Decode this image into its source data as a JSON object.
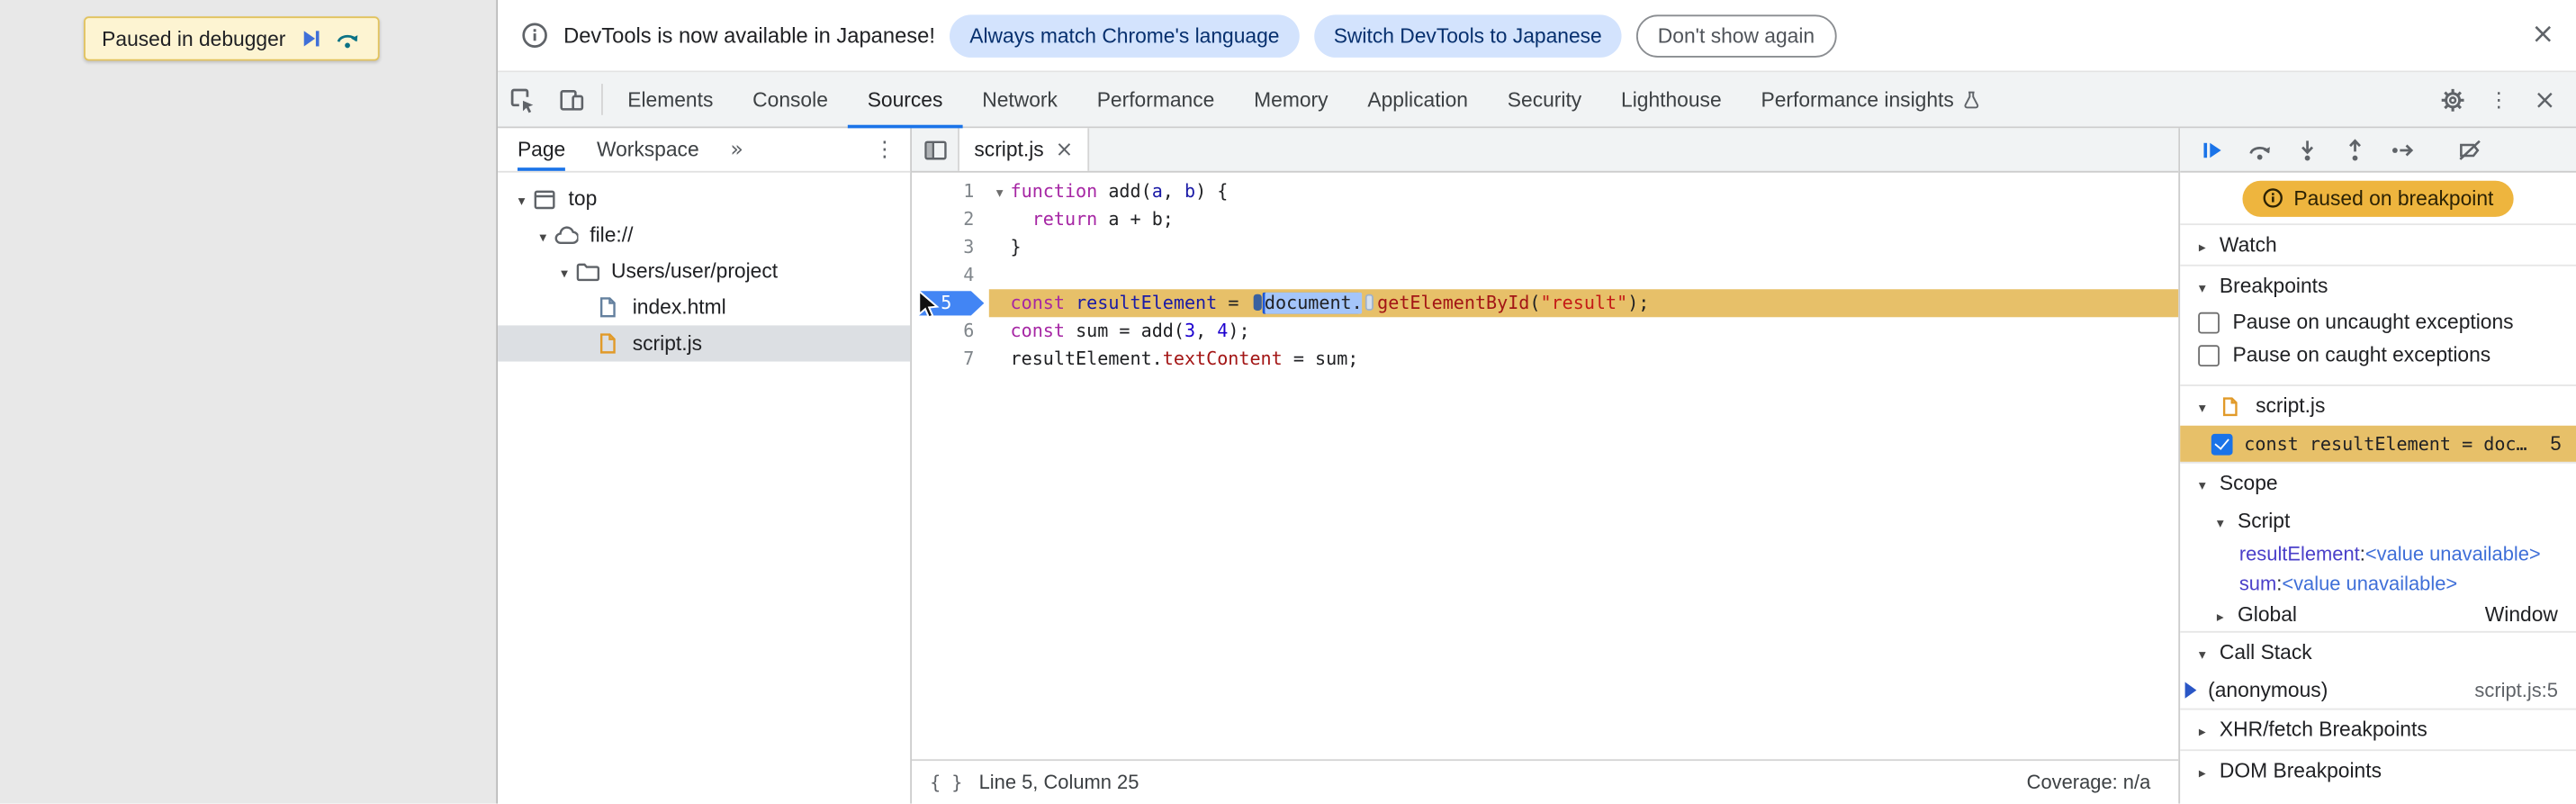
{
  "page": {
    "paused_toast_label": "Paused in debugger"
  },
  "infobar": {
    "message": "DevTools is now available in Japanese!",
    "actions": [
      "Always match Chrome's language",
      "Switch DevTools to Japanese",
      "Don't show again"
    ]
  },
  "icons": {
    "more_tabs": "»",
    "menu": "⋮",
    "close": "×",
    "braces": "{ }"
  },
  "colors": {
    "accent_blue": "#1a73e8",
    "execution_line": "#e7c069",
    "paused_badge": "#eeb53e",
    "selection_blue": "#a4c5fa"
  },
  "toolbar": {
    "tabs": [
      {
        "label": "Elements"
      },
      {
        "label": "Console"
      },
      {
        "label": "Sources"
      },
      {
        "label": "Network"
      },
      {
        "label": "Performance"
      },
      {
        "label": "Memory"
      },
      {
        "label": "Application"
      },
      {
        "label": "Security"
      },
      {
        "label": "Lighthouse"
      },
      {
        "label": "Performance insights",
        "icon": "flask"
      }
    ],
    "selected_tab": "Sources"
  },
  "navigator": {
    "tabs": [
      "Page",
      "Workspace"
    ],
    "selected_tab": "Page",
    "tree": [
      {
        "label": "top",
        "icon": "frame",
        "depth": 0,
        "expanded": true
      },
      {
        "label": "file://",
        "icon": "cloud",
        "depth": 1,
        "expanded": true
      },
      {
        "label": "Users/user/project",
        "icon": "folder",
        "depth": 2,
        "expanded": true
      },
      {
        "label": "index.html",
        "icon": "file-html",
        "depth": 3
      },
      {
        "label": "script.js",
        "icon": "file-js",
        "depth": 3,
        "selected": true
      }
    ]
  },
  "editor": {
    "tab_label": "script.js",
    "lines": [
      {
        "num": 1,
        "fold": true,
        "tokens": [
          {
            "t": "function",
            "c": "kw"
          },
          {
            "t": " add("
          },
          {
            "t": "a",
            "c": "def"
          },
          {
            "t": ", "
          },
          {
            "t": "b",
            "c": "def"
          },
          {
            "t": ") {"
          }
        ]
      },
      {
        "num": 2,
        "tokens": [
          {
            "t": "  "
          },
          {
            "t": "return",
            "c": "kw"
          },
          {
            "t": " a + b;"
          }
        ]
      },
      {
        "num": 3,
        "tokens": [
          {
            "t": "}"
          }
        ]
      },
      {
        "num": 4,
        "tokens": []
      },
      {
        "num": 5,
        "current": true,
        "breakpoint": true,
        "tokens": [
          {
            "t": "const",
            "c": "kw"
          },
          {
            "t": " "
          },
          {
            "t": "resultElement",
            "c": "def"
          },
          {
            "t": " = "
          },
          {
            "marker": "inline-breakpoint-active"
          },
          {
            "t": "document.",
            "c": "sel"
          },
          {
            "marker": "inline-breakpoint"
          },
          {
            "t": "getElementById",
            "c": "prop"
          },
          {
            "t": "("
          },
          {
            "t": "\"result\"",
            "c": "str"
          },
          {
            "t": ");"
          }
        ]
      },
      {
        "num": 6,
        "tokens": [
          {
            "t": "const",
            "c": "kw"
          },
          {
            "t": " sum = add("
          },
          {
            "t": "3",
            "c": "num"
          },
          {
            "t": ", "
          },
          {
            "t": "4",
            "c": "num"
          },
          {
            "t": ");"
          }
        ]
      },
      {
        "num": 7,
        "tokens": [
          {
            "t": "resultElement."
          },
          {
            "t": "textContent",
            "c": "prop"
          },
          {
            "t": " = sum;"
          }
        ]
      }
    ],
    "status": {
      "position": "Line 5, Column 25",
      "coverage": "Coverage: n/a"
    }
  },
  "debugger": {
    "paused_message": "Paused on breakpoint",
    "watch_label": "Watch",
    "breakpoints": {
      "label": "Breakpoints",
      "pause_uncaught": "Pause on uncaught exceptions",
      "pause_caught": "Pause on caught exceptions",
      "file_group": "script.js",
      "entry": {
        "label": "const resultElement = doc…",
        "line": "5",
        "checked": true
      }
    },
    "scope": {
      "label": "Scope",
      "script_label": "Script",
      "variables": [
        {
          "name": "resultElement",
          "value": "<value unavailable>"
        },
        {
          "name": "sum",
          "value": "<value unavailable>"
        }
      ],
      "global_label": "Global",
      "global_value": "Window"
    },
    "call_stack": {
      "label": "Call Stack",
      "frames": [
        {
          "name": "(anonymous)",
          "location": "script.js:5"
        }
      ]
    },
    "xhr_label": "XHR/fetch Breakpoints",
    "dom_label": "DOM Breakpoints"
  }
}
